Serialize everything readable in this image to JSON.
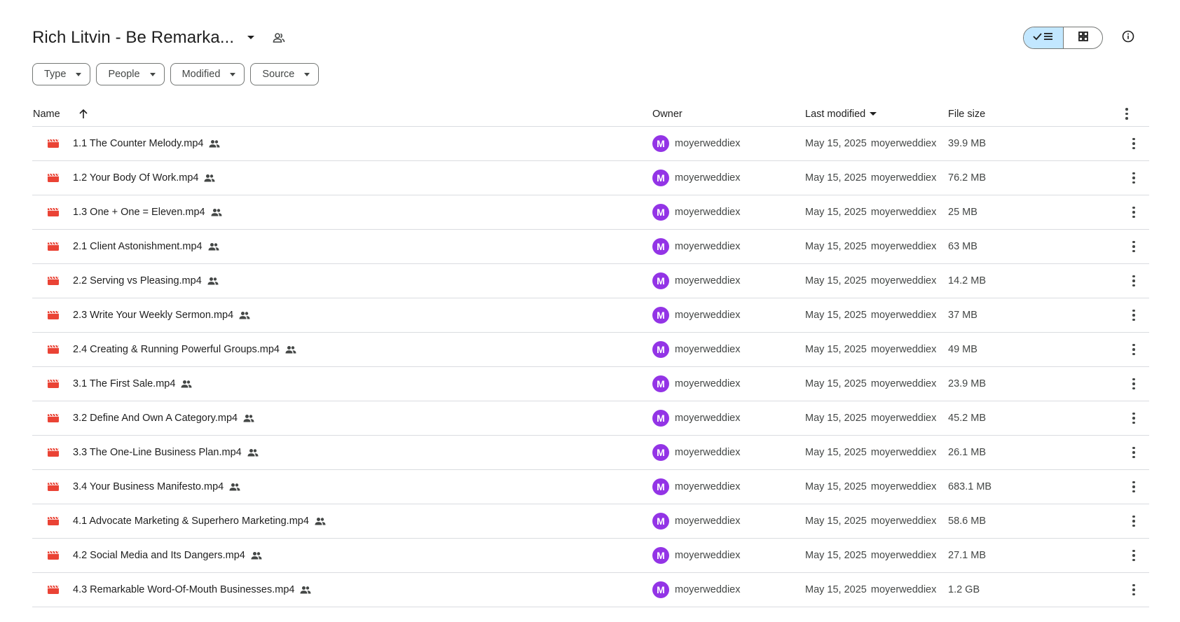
{
  "header": {
    "title": "Rich Litvin - Be Remarka...",
    "title_caret_icon": "caret-down-icon",
    "shared_icon": "people-icon",
    "view_list_icon": "check-list-icon",
    "view_grid_icon": "grid-icon",
    "info_icon": "info-icon"
  },
  "filters": [
    {
      "label": "Type"
    },
    {
      "label": "People"
    },
    {
      "label": "Modified"
    },
    {
      "label": "Source"
    }
  ],
  "columns": {
    "name": "Name",
    "owner": "Owner",
    "modified": "Last modified",
    "size": "File size"
  },
  "rows": [
    {
      "name": "1.1 The Counter Melody.mp4",
      "owner": "moyerweddiex",
      "date": "May 15, 2025",
      "by": "moyerweddiex",
      "size": "39.9 MB"
    },
    {
      "name": "1.2 Your Body Of Work.mp4",
      "owner": "moyerweddiex",
      "date": "May 15, 2025",
      "by": "moyerweddiex",
      "size": "76.2 MB"
    },
    {
      "name": "1.3 One + One = Eleven.mp4",
      "owner": "moyerweddiex",
      "date": "May 15, 2025",
      "by": "moyerweddiex",
      "size": "25 MB"
    },
    {
      "name": "2.1 Client Astonishment.mp4",
      "owner": "moyerweddiex",
      "date": "May 15, 2025",
      "by": "moyerweddiex",
      "size": "63 MB"
    },
    {
      "name": "2.2 Serving vs Pleasing.mp4",
      "owner": "moyerweddiex",
      "date": "May 15, 2025",
      "by": "moyerweddiex",
      "size": "14.2 MB"
    },
    {
      "name": "2.3 Write Your Weekly Sermon.mp4",
      "owner": "moyerweddiex",
      "date": "May 15, 2025",
      "by": "moyerweddiex",
      "size": "37 MB"
    },
    {
      "name": "2.4 Creating & Running Powerful Groups.mp4",
      "owner": "moyerweddiex",
      "date": "May 15, 2025",
      "by": "moyerweddiex",
      "size": "49 MB"
    },
    {
      "name": "3.1 The First Sale.mp4",
      "owner": "moyerweddiex",
      "date": "May 15, 2025",
      "by": "moyerweddiex",
      "size": "23.9 MB"
    },
    {
      "name": "3.2 Define And Own A Category.mp4",
      "owner": "moyerweddiex",
      "date": "May 15, 2025",
      "by": "moyerweddiex",
      "size": "45.2 MB"
    },
    {
      "name": "3.3 The One-Line Business Plan.mp4",
      "owner": "moyerweddiex",
      "date": "May 15, 2025",
      "by": "moyerweddiex",
      "size": "26.1 MB"
    },
    {
      "name": "3.4 Your Business Manifesto.mp4",
      "owner": "moyerweddiex",
      "date": "May 15, 2025",
      "by": "moyerweddiex",
      "size": "683.1 MB"
    },
    {
      "name": "4.1 Advocate Marketing & Superhero Marketing.mp4",
      "owner": "moyerweddiex",
      "date": "May 15, 2025",
      "by": "moyerweddiex",
      "size": "58.6 MB"
    },
    {
      "name": "4.2 Social Media and Its Dangers.mp4",
      "owner": "moyerweddiex",
      "date": "May 15, 2025",
      "by": "moyerweddiex",
      "size": "27.1 MB"
    },
    {
      "name": "4.3 Remarkable Word-Of-Mouth Businesses.mp4",
      "owner": "moyerweddiex",
      "date": "May 15, 2025",
      "by": "moyerweddiex",
      "size": "1.2 GB"
    }
  ],
  "avatar_initial": "M",
  "colors": {
    "accent": "#c2e7ff",
    "avatar": "#9334e6",
    "video_icon": "#ea4335"
  }
}
